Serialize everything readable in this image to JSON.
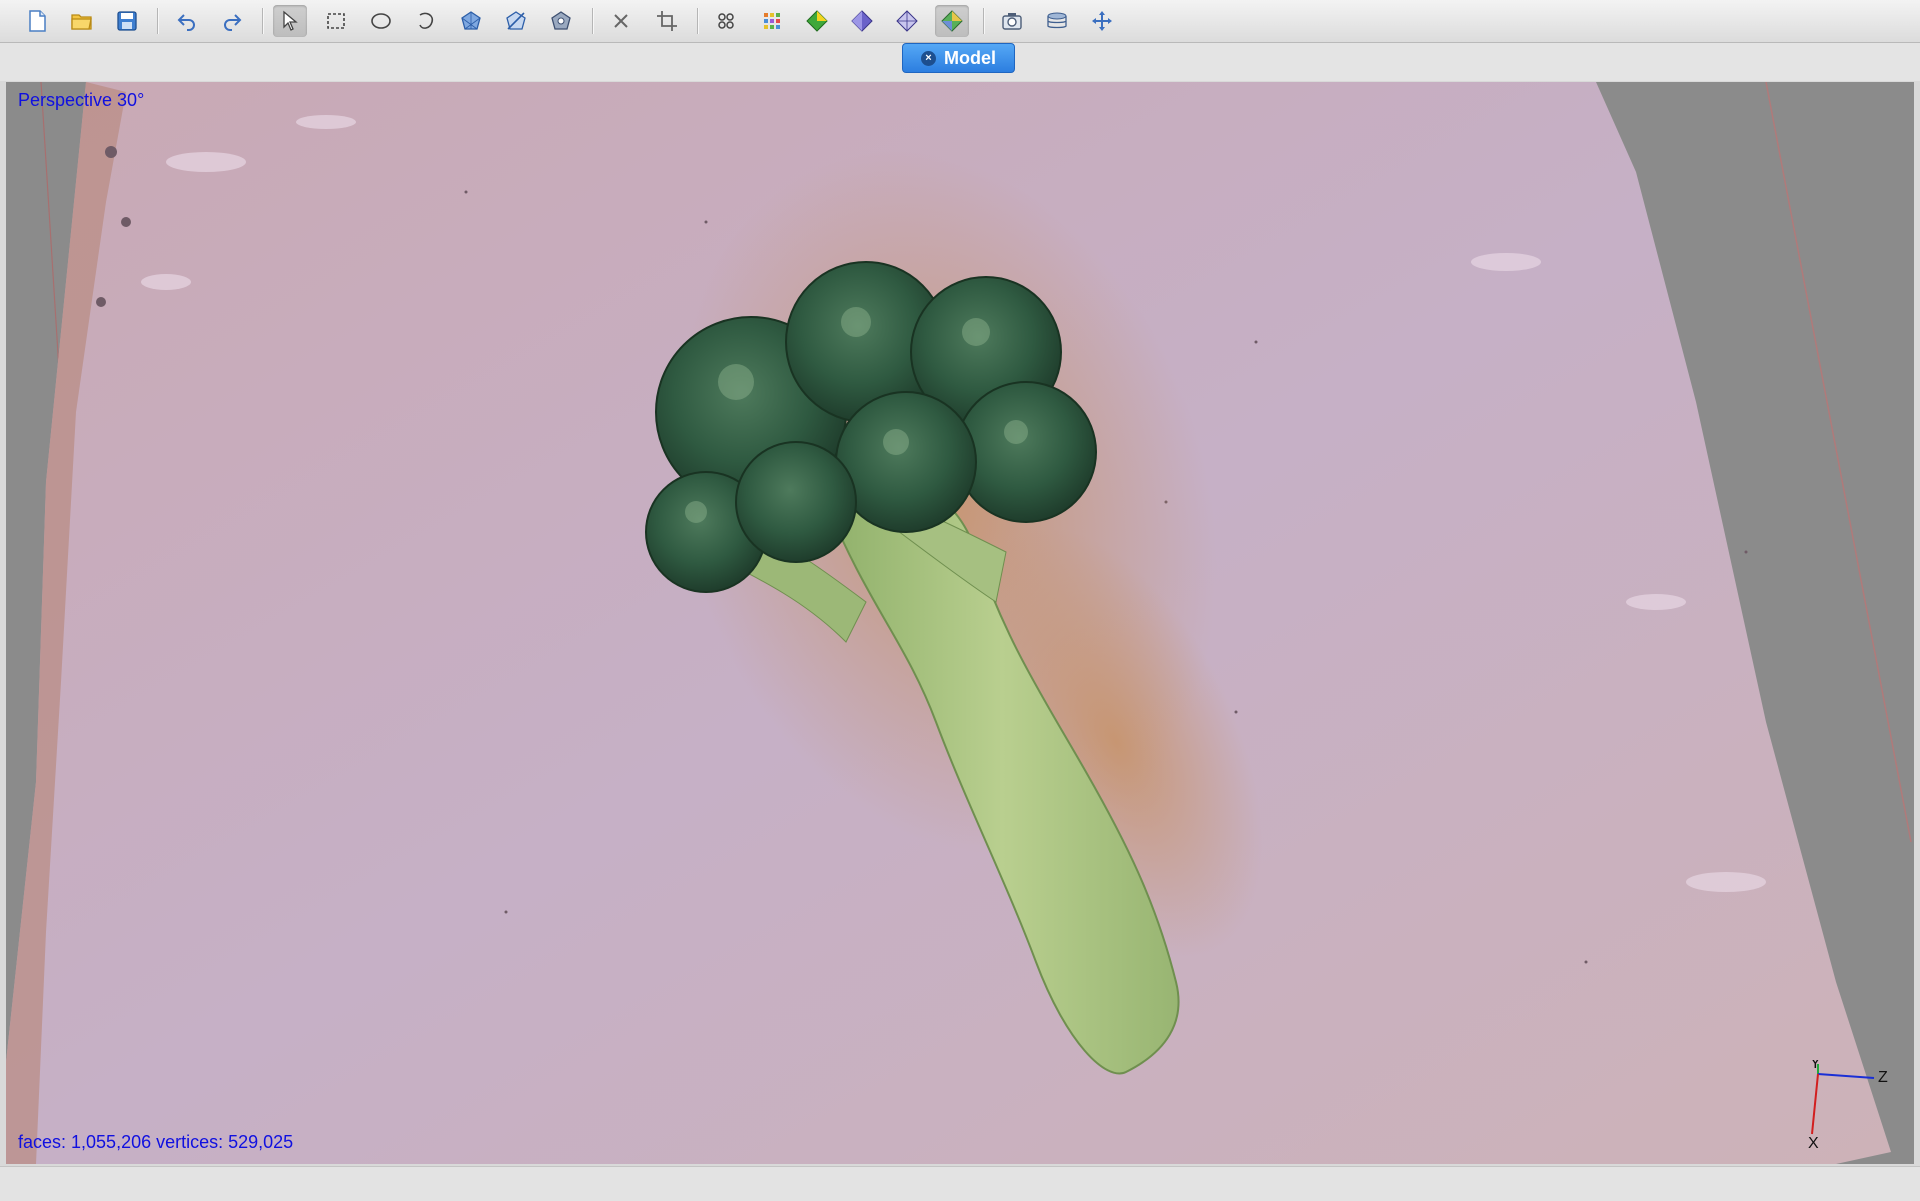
{
  "toolbar": {
    "icons": [
      {
        "name": "new-file-icon"
      },
      {
        "name": "open-folder-icon"
      },
      {
        "name": "save-icon"
      },
      {
        "name": "undo-icon"
      },
      {
        "name": "redo-icon"
      },
      {
        "name": "select-arrow-icon"
      },
      {
        "name": "rectangle-select-icon"
      },
      {
        "name": "ellipse-select-icon"
      },
      {
        "name": "lasso-select-icon"
      },
      {
        "name": "select-faces-icon"
      },
      {
        "name": "select-invert-icon"
      },
      {
        "name": "select-connected-icon"
      },
      {
        "name": "delete-icon"
      },
      {
        "name": "crop-icon"
      },
      {
        "name": "grid-4-icon"
      },
      {
        "name": "grid-9-icon"
      },
      {
        "name": "shade-green-icon"
      },
      {
        "name": "shade-purple-icon"
      },
      {
        "name": "shade-wire-icon"
      },
      {
        "name": "texture-icon"
      },
      {
        "name": "camera-icon"
      },
      {
        "name": "layers-icon"
      },
      {
        "name": "move-icon"
      }
    ],
    "active_tool": "select-arrow-icon"
  },
  "tabs": [
    {
      "label": "Model",
      "active": true
    }
  ],
  "viewport": {
    "projection_label": "Perspective 30°",
    "stats_label": "faces: 1,055,206 vertices: 529,025",
    "axis_labels": {
      "x": "X",
      "y": "Y",
      "z": "Z"
    }
  },
  "colors": {
    "overlay_text": "#1010e0",
    "tab_active": "#2c7ee0",
    "background": "#8c8c8c",
    "surface": "#cdb2bf"
  }
}
